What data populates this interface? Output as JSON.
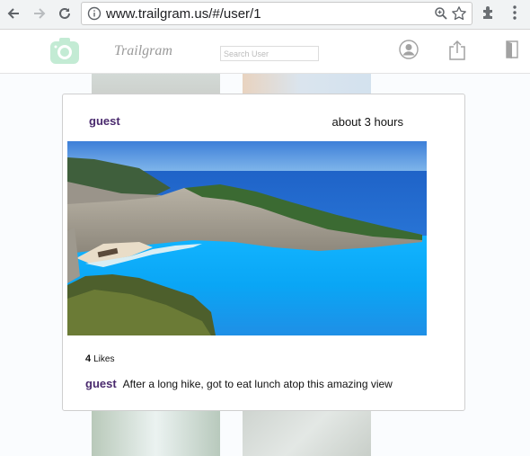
{
  "browser": {
    "url": "www.trailgram.us/#/user/1"
  },
  "app": {
    "brand": "Trailgram",
    "search_placeholder": "Search User"
  },
  "modal": {
    "username": "guest",
    "timestamp": "about 3 hours",
    "likes_count": "4",
    "likes_label": "Likes",
    "comment_user": "guest",
    "comment_text": "After a long hike, got to eat lunch atop this amazing view"
  },
  "colors": {
    "username": "#4a2a6e",
    "logo": "#57c785"
  },
  "icons": [
    "back-arrow-icon",
    "forward-arrow-icon",
    "reload-icon",
    "info-icon",
    "zoom-icon",
    "star-icon",
    "puzzle-icon",
    "kebab-menu-icon",
    "camera-logo-icon",
    "profile-icon",
    "share-icon",
    "logout-icon"
  ]
}
